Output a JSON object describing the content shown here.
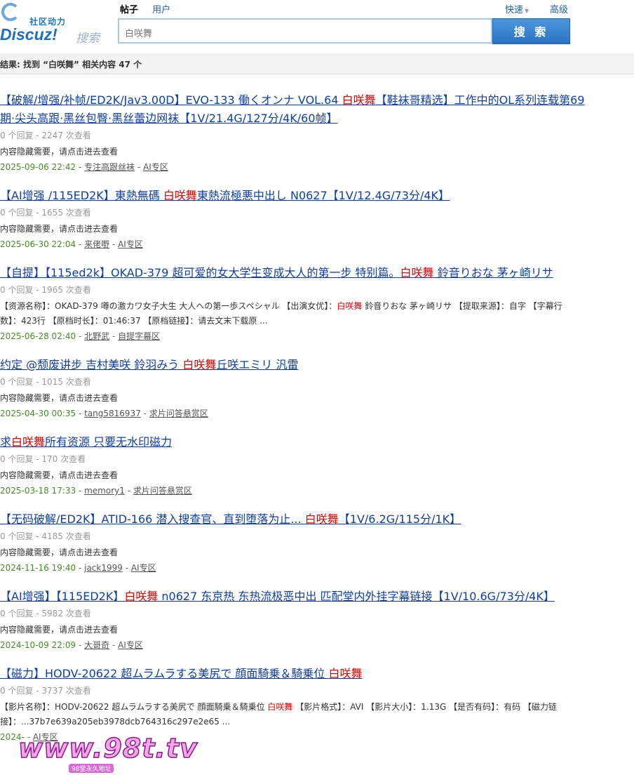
{
  "header": {
    "logo_community": "社区动力",
    "logo_brand": "Discuz!",
    "logo_search": "搜索",
    "tabs": [
      {
        "label": "帖子",
        "active": true
      },
      {
        "label": "用户",
        "active": false
      }
    ],
    "quick_label": "快速",
    "advanced_label": "高级",
    "search_value": "白咲舞",
    "search_button": "搜 索"
  },
  "result_summary": "结果: 找到 “白咲舞” 相关内容 47 个",
  "results": [
    {
      "title_parts": [
        "【破解/增强/补帧/ED2K/Jav3.00D】EVO-133 働くオンナ VOL.64 ",
        "白咲舞",
        "【鞋袜哥精选】工作中的OL系列连载第69期·尖头高跟·黑丝包臀·黑丝蕾边网袜【1V/21.4G/127分/4K/60帧】"
      ],
      "stats": "0 个回复 - 2247 次查看",
      "summary_parts": [
        "内容隐藏需要，请点击进去查看"
      ],
      "date": "2025-09-06 22:42",
      "author": "专注高跟丝袜",
      "forum": "AI专区"
    },
    {
      "title_parts": [
        "【AI增强 /115ED2K】東熱無碼 ",
        "白咲舞",
        "東熱流極悪中出し N0627【1V/12.4G/73分/4K】"
      ],
      "stats": "0 个回复 - 1655 次查看",
      "summary_parts": [
        "内容隐藏需要，请点击进去查看"
      ],
      "date": "2025-06-30 22:04",
      "author": "来佬嘢",
      "forum": "AI专区"
    },
    {
      "title_parts": [
        "【自提】【115ed2k】OKAD-379 超可爱的女大学生变成大人的第一步 特别篇。",
        "白咲舞",
        " 鈴音りおな 茅ヶ崎リサ"
      ],
      "stats": "0 个回复 - 1965 次查看",
      "summary_parts": [
        "【资源名称】：OKAD-379 噂の激カワ女子大生 大人への第一歩スペシャル 【出演女优】：",
        "白咲舞",
        " 鈴音りおな 茅ヶ崎リサ 【提取来源】：自字 【字幕行数】：423行 【原档时长】：01:46:37 【原档链接】：请去文末下载原 ..."
      ],
      "date": "2025-06-28 02:40",
      "author": "北野武",
      "forum": "自提字幕区"
    },
    {
      "title_parts": [
        "约定 @颓废讲步 吉村美咲 鈴羽みう ",
        "白咲舞",
        "丘咲エミリ 汎雷"
      ],
      "stats": "0 个回复 - 1015 次查看",
      "summary_parts": [
        "内容隐藏需要，请点击进去查看"
      ],
      "date": "2025-04-30 00:35",
      "author": "tang5816937",
      "forum": "求片问答悬赏区"
    },
    {
      "title_parts": [
        "求",
        "白咲舞",
        "所有资源 只要无水印磁力"
      ],
      "stats": "0 个回复 - 170 次查看",
      "summary_parts": [
        "内容隐藏需要，请点击进去查看"
      ],
      "date": "2025-03-18 17:33",
      "author": "memory1",
      "forum": "求片问答悬赏区"
    },
    {
      "title_parts": [
        "【无码破解/ED2K】ATID-166 潜入搜查官、直到堕落为止... ",
        "白咲舞",
        "【1V/6.2G/115分/1K】"
      ],
      "stats": "0 个回复 - 4185 次查看",
      "summary_parts": [
        "内容隐藏需要，请点击进去查看"
      ],
      "date": "2024-11-16 19:40",
      "author": "jack1999",
      "forum": "AI专区"
    },
    {
      "title_parts": [
        "【AI增强】【115ED2K】",
        "白咲舞",
        " n0627 东京热 东热流极恶中出 匹配堂内外挂字幕链接【1V/10.6G/73分/4K】"
      ],
      "stats": "0 个回复 - 5982 次查看",
      "summary_parts": [
        "内容隐藏需要，请点击进去查看"
      ],
      "date": "2024-10-09 22:09",
      "author": "大哥奇",
      "forum": "AI专区"
    },
    {
      "title_parts": [
        "【磁力】HODV-20622 超ムラムラする美尻で 顔面騎乗＆騎乗位 ",
        "白咲舞",
        ""
      ],
      "stats": "0 个回复 - 3737 次查看",
      "summary_parts": [
        "【影片名称】：HODV-20622 超ムラムラする美尻で 顔面騎乗＆騎乗位 ",
        "白咲舞",
        " 【影片格式】：AVI 【影片大小】：1.13G 【是否有码】：有码 【磁力链接】：...37b7e639a205eb3978dcb764316c297e2e65 ..."
      ],
      "date": "2024-",
      "author": "",
      "forum": "AI专区"
    }
  ],
  "watermark": {
    "text": "www.98t.tv",
    "sub": "98堂永久地址"
  }
}
